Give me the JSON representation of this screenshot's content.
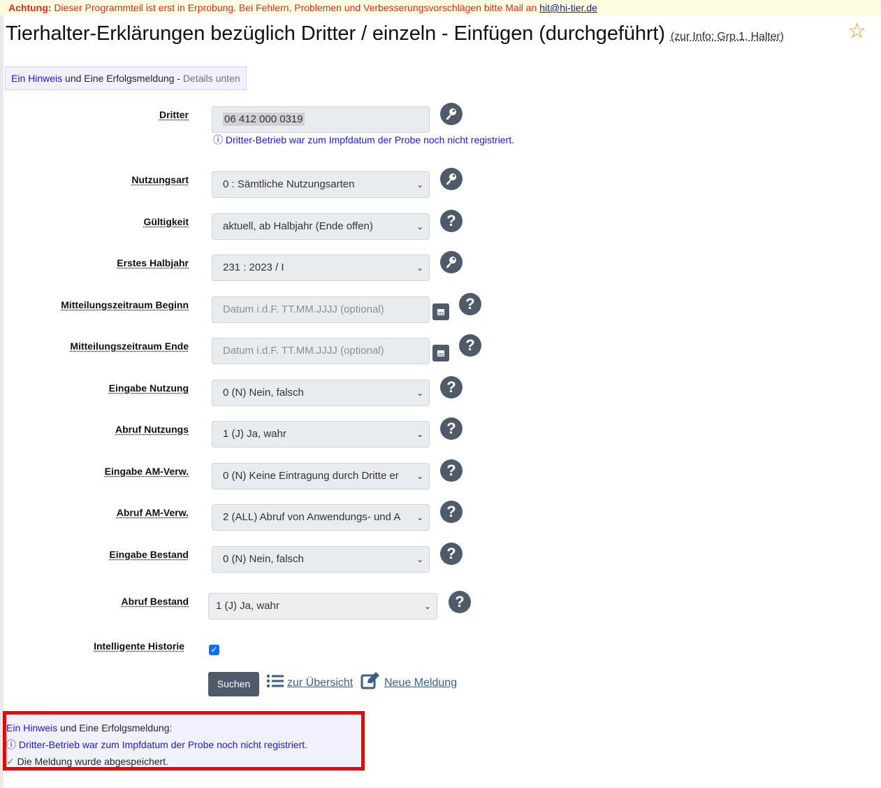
{
  "banner": {
    "prefix": "Achtung:",
    "text": "Dieser Programmteil ist erst in Erprobung. Bei Fehlern, Problemen und Verbesserungsvorschlägen bitte Mail an",
    "email": "hit@hi-tier.de"
  },
  "page": {
    "title": "Tierhalter-Erklärungen bezüglich Dritter / einzeln - Einfügen (durchgeführt)",
    "info": "(zur Info: Grp.1, Halter)",
    "star": "☆"
  },
  "hint": {
    "link": "Ein Hinweis",
    "middle": "und Eine Erfolgsmeldung -",
    "details": "Details unten"
  },
  "form": {
    "dritter": {
      "label": "Dritter",
      "value": "06 412 000 0319",
      "info": "ⓘ Dritter-Betrieb war zum Impfdatum der Probe noch nicht registriert."
    },
    "nutzungsart": {
      "label": "Nutzungsart",
      "value": "0 : Sämtliche Nutzungsarten"
    },
    "gueltigkeit": {
      "label": "Gültigkeit",
      "value": "aktuell, ab Halbjahr (Ende offen)"
    },
    "erstes_halbjahr": {
      "label": "Erstes Halbjahr",
      "value": "231 : 2023 / I"
    },
    "mz_beginn": {
      "label": "Mitteilungszeitraum Beginn",
      "placeholder": "Datum i.d.F. TT.MM.JJJJ (optional)"
    },
    "mz_ende": {
      "label": "Mitteilungszeitraum Ende",
      "placeholder": "Datum i.d.F. TT.MM.JJJJ (optional)"
    },
    "eingabe_nutzung": {
      "label": "Eingabe Nutzung",
      "value": "0 (N) Nein, falsch"
    },
    "abruf_nutzungs": {
      "label": "Abruf Nutzungs",
      "value": "1 (J) Ja, wahr"
    },
    "eingabe_am": {
      "label": "Eingabe AM-Verw.",
      "value": "0 (N) Keine Eintragung durch Dritte er"
    },
    "abruf_am": {
      "label": "Abruf AM-Verw.",
      "value": "2 (ALL) Abruf von Anwendungs- und A"
    },
    "eingabe_bestand": {
      "label": "Eingabe Bestand",
      "value": "0 (N) Nein, falsch"
    },
    "abruf_bestand": {
      "label": "Abruf Bestand",
      "value": "1 (J) Ja, wahr"
    },
    "historie": {
      "label": "Intelligente Historie",
      "checked": true
    }
  },
  "actions": {
    "search": "Suchen",
    "overview": "zur Übersicht",
    "new": "Neue Meldung"
  },
  "messages": {
    "head_link": "Ein Hinweis",
    "head_rest": "und Eine Erfolgsmeldung:",
    "info": "ⓘ Dritter-Betrieb war zum Impfdatum der Probe noch nicht registriert.",
    "check": "✓",
    "success": "Die Meldung wurde abgespeichert."
  },
  "icons": {
    "key": "key-icon",
    "help": "help-icon",
    "calendar": "calendar-icon",
    "list": "list-icon",
    "edit": "edit-icon"
  }
}
